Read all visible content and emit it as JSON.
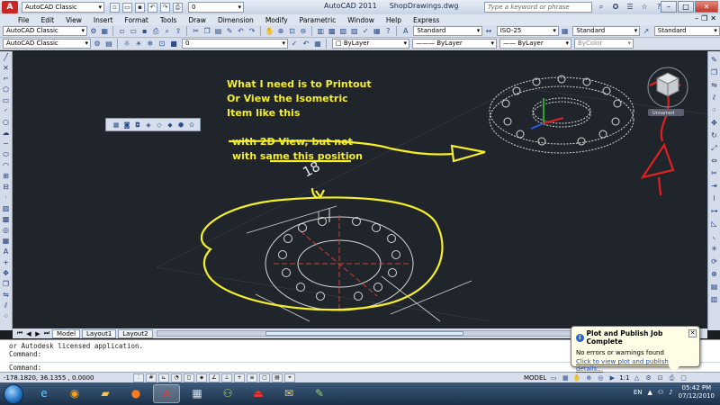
{
  "title_bar": {
    "workspace": "AutoCAD Classic",
    "layer_value": "0",
    "app_title": "AutoCAD 2011",
    "document": "ShopDrawings.dwg",
    "search_placeholder": "Type a keyword or phrase"
  },
  "menu": {
    "items": [
      "File",
      "Edit",
      "View",
      "Insert",
      "Format",
      "Tools",
      "Draw",
      "Dimension",
      "Modify",
      "Parametric",
      "Window",
      "Help",
      "Express"
    ]
  },
  "toolbar1": {
    "workspace": "AutoCAD Classic",
    "text_style": "Standard",
    "dim_style": "ISO-25",
    "table_style": "Standard",
    "multileader_style": "Standard"
  },
  "toolbar2": {
    "layer": "0",
    "color": "ByLayer",
    "linetype": "ByLayer",
    "lineweight": "ByLayer",
    "plot_style": "ByColor"
  },
  "annotations": {
    "line1": "What I need is to Printout",
    "line2": "Or View the Isometric",
    "line3": "Item like this",
    "line4": "with 2D View, but not",
    "line5": "with same this position"
  },
  "drawing": {
    "dimension_text": "18",
    "viewcube_label": "Unnamed"
  },
  "layout_tabs": [
    "Model",
    "Layout1",
    "Layout2"
  ],
  "command_line": {
    "history1": "or Autodesk licensed application.",
    "history2": "Command:",
    "prompt": "Command:"
  },
  "status_bar": {
    "coordinates": "-178.1820, 36.1355 , 0.0000",
    "space": "MODEL",
    "annotation_scale": "1:1"
  },
  "notification": {
    "title": "Plot and Publish Job Complete",
    "message": "No errors or warnings found",
    "link": "Click to view plot and publish details..."
  },
  "taskbar": {
    "language": "EN",
    "time": "05:42 PM",
    "date": "07/12/2010"
  },
  "colors": {
    "canvas": "#20242b",
    "annotation": "#f4ef2a",
    "markup_red": "#e02020"
  }
}
